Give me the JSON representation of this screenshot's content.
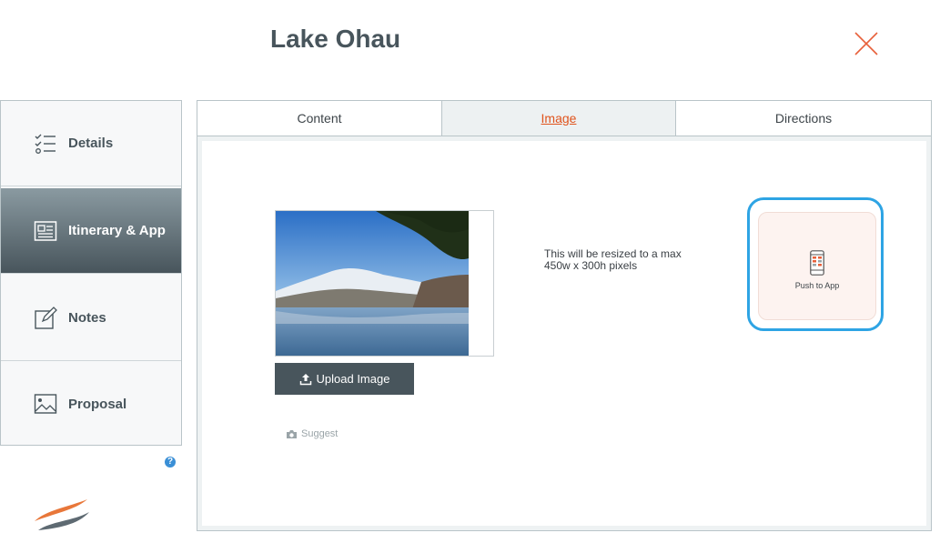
{
  "header": {
    "title": "Lake Ohau"
  },
  "sidebar": {
    "items": [
      {
        "label": "Details",
        "icon": "checklist-icon"
      },
      {
        "label": "Itinerary & App",
        "icon": "newspaper-icon"
      },
      {
        "label": "Notes",
        "icon": "edit-icon"
      },
      {
        "label": "Proposal",
        "icon": "image-icon"
      }
    ],
    "active_index": 1
  },
  "tabs": [
    {
      "label": "Content"
    },
    {
      "label": "Image"
    },
    {
      "label": "Directions"
    }
  ],
  "image_panel": {
    "upload_label": "Upload Image",
    "suggest_label": "Suggest",
    "resize_note": "This will be resized to a max 450w x 300h pixels",
    "push_label": "Push to App"
  },
  "colors": {
    "accent": "#e0531c",
    "sidebar_active": "#48555c",
    "focus_ring": "#2ea4e4"
  },
  "help_label": "?"
}
